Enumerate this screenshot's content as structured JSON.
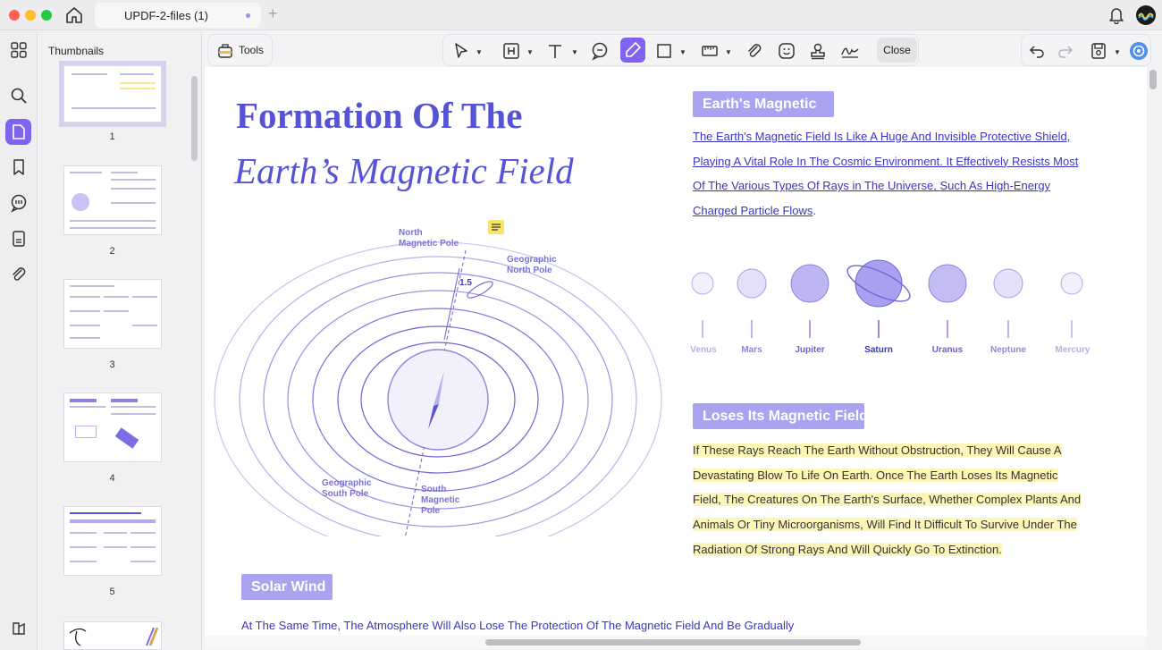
{
  "window": {
    "tab_title": "UPDF-2-files (1)"
  },
  "sidebar": {
    "title": "Thumbnails",
    "pages": [
      "1",
      "2",
      "3",
      "4",
      "5"
    ]
  },
  "toolbar": {
    "tools_label": "Tools",
    "close_label": "Close"
  },
  "document": {
    "title_line1": "Formation Of The",
    "title_line2": "Earth’s Magnetic Field",
    "diagram": {
      "north_magnetic_pole": "North\nMagnetic Pole",
      "geographic_north_pole": "Geographic\nNorth Pole",
      "angle": "1.5",
      "geographic_south_pole": "Geographic\nSouth Pole",
      "south_magnetic_pole": "South\nMagnetic\nPole"
    },
    "section_magnetic": {
      "heading": "Earth's Magnetic",
      "lines": [
        "The Earth's Magnetic Field Is Like A Huge And Invisible Protective Shield,",
        "Playing A Vital Role In The Cosmic Environment. It Effectively Resists Most",
        "Of The Various Types Of Rays in The Universe, Such As High-Energy",
        "Charged Particle Flows"
      ],
      "tail": "."
    },
    "planets": [
      "Venus",
      "Mars",
      "Jupiter",
      "Saturn",
      "Uranus",
      "Neptune",
      "Mercury"
    ],
    "section_loses": {
      "heading": "Loses Its Magnetic Field",
      "lines": [
        "If These Rays Reach The Earth Without Obstruction, They Will Cause A",
        "Devastating Blow To Life On Earth. Once The Earth Loses Its Magnetic",
        "Field, The Creatures On The Earth's Surface, Whether Complex Plants And",
        "Animals Or Tiny Microorganisms, Will Find It Difficult To Survive Under The",
        "Radiation Of Strong Rays And Will Quickly Go To Extinction."
      ]
    },
    "section_solar": {
      "heading": "Solar Wind",
      "line": "At The Same Time, The Atmosphere Will Also Lose The Protection Of The Magnetic Field And Be Gradually"
    }
  },
  "colors": {
    "accent": "#8063ef",
    "title": "#5753d6",
    "heading_bg": "#a9a3f0",
    "highlight": "#fdf6b7",
    "annotation_box": "#e2553a"
  }
}
